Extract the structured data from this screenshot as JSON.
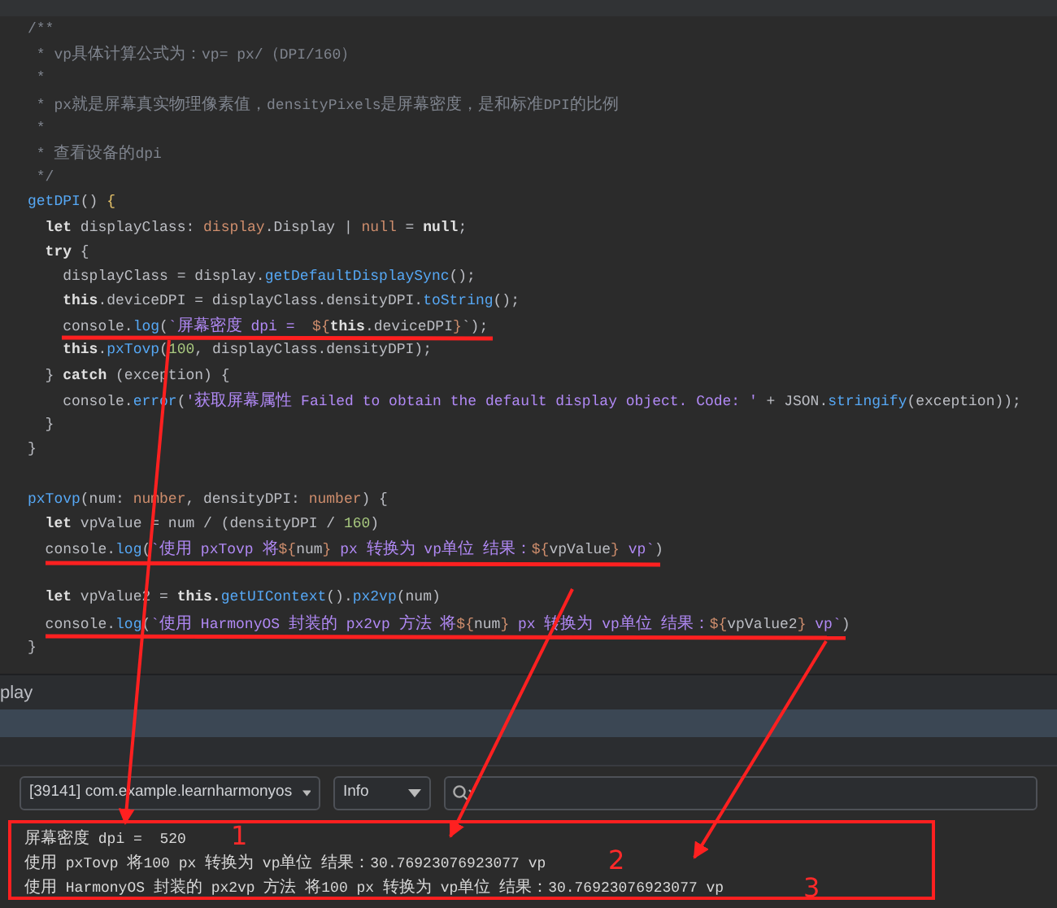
{
  "editor": {
    "lines": [
      {
        "kind": "code",
        "segs": [
          {
            "t": "/**",
            "color": "#7f848e"
          }
        ]
      },
      {
        "kind": "code",
        "segs": [
          {
            "t": " * vp具体计算公式为：vp= px/（DPI/160）",
            "color": "#7f848e"
          }
        ]
      },
      {
        "kind": "code",
        "segs": [
          {
            "t": " *",
            "color": "#7f848e"
          }
        ]
      },
      {
        "kind": "code",
        "segs": [
          {
            "t": " * px就是屏幕真实物理像素值，densityPixels是屏幕密度，是和标准DPI的比例",
            "color": "#7f848e"
          }
        ]
      },
      {
        "kind": "code",
        "segs": [
          {
            "t": " *",
            "color": "#7f848e"
          }
        ]
      },
      {
        "kind": "code",
        "segs": [
          {
            "t": " * 查看设备的dpi",
            "color": "#7f848e"
          }
        ]
      },
      {
        "kind": "code",
        "segs": [
          {
            "t": " */",
            "color": "#7f848e"
          }
        ]
      },
      {
        "kind": "code",
        "segs": [
          {
            "t": "getDPI",
            "color": "#56a8f5"
          },
          {
            "t": "() ",
            "color": "#bcbec4"
          },
          {
            "t": "{",
            "color": "#e8c46a"
          }
        ]
      },
      {
        "kind": "code",
        "segs": [
          {
            "t": "  let",
            "color": "#e0e0e0",
            "bold": true
          },
          {
            "t": " displayClass: ",
            "color": "#bcbec4"
          },
          {
            "t": "display",
            "color": "#cf8e6d"
          },
          {
            "t": ".Display | ",
            "color": "#bcbec4"
          },
          {
            "t": "null",
            "color": "#cf8e6d"
          },
          {
            "t": " = ",
            "color": "#bcbec4"
          },
          {
            "t": "null",
            "color": "#e0e0e0",
            "bold": true
          },
          {
            "t": ";",
            "color": "#bcbec4"
          }
        ]
      },
      {
        "kind": "code",
        "segs": [
          {
            "t": "  try",
            "color": "#e0e0e0",
            "bold": true
          },
          {
            "t": " {",
            "color": "#bcbec4"
          }
        ]
      },
      {
        "kind": "code",
        "segs": [
          {
            "t": "    displayClass = display.",
            "color": "#bcbec4"
          },
          {
            "t": "getDefaultDisplaySync",
            "color": "#56a8f5"
          },
          {
            "t": "();",
            "color": "#bcbec4"
          }
        ]
      },
      {
        "kind": "code",
        "segs": [
          {
            "t": "    this",
            "color": "#e0e0e0",
            "bold": true
          },
          {
            "t": ".deviceDPI = displayClass.densityDPI.",
            "color": "#bcbec4"
          },
          {
            "t": "toString",
            "color": "#56a8f5"
          },
          {
            "t": "();",
            "color": "#bcbec4"
          }
        ]
      },
      {
        "kind": "code",
        "segs": [
          {
            "t": "    console.",
            "color": "#bcbec4"
          },
          {
            "t": "log",
            "color": "#56a8f5"
          },
          {
            "t": "(",
            "color": "#bcbec4"
          },
          {
            "t": "`屏幕密度 dpi =  ",
            "color": "#b189f5"
          },
          {
            "t": "${",
            "color": "#cf8e6d"
          },
          {
            "t": "this",
            "color": "#e0e0e0",
            "bold": true
          },
          {
            "t": ".deviceDPI",
            "color": "#bcbec4"
          },
          {
            "t": "}",
            "color": "#cf8e6d"
          },
          {
            "t": "`);",
            "color": "#bcbec4"
          }
        ]
      },
      {
        "kind": "code",
        "segs": [
          {
            "t": "    this",
            "color": "#e0e0e0",
            "bold": true
          },
          {
            "t": ".",
            "color": "#bcbec4"
          },
          {
            "t": "pxTovp",
            "color": "#56a8f5"
          },
          {
            "t": "(",
            "color": "#bcbec4"
          },
          {
            "t": "100",
            "color": "#a8c97f"
          },
          {
            "t": ", displayClass.densityDPI);",
            "color": "#bcbec4"
          }
        ]
      },
      {
        "kind": "code",
        "segs": [
          {
            "t": "  } ",
            "color": "#bcbec4"
          },
          {
            "t": "catch",
            "color": "#e0e0e0",
            "bold": true
          },
          {
            "t": " (exception) {",
            "color": "#bcbec4"
          }
        ]
      },
      {
        "kind": "code",
        "segs": [
          {
            "t": "    console.",
            "color": "#bcbec4"
          },
          {
            "t": "error",
            "color": "#56a8f5"
          },
          {
            "t": "(",
            "color": "#bcbec4"
          },
          {
            "t": "'获取屏幕属性 Failed to obtain the default display object. Code: '",
            "color": "#b189f5"
          },
          {
            "t": " + JSON.",
            "color": "#bcbec4"
          },
          {
            "t": "stringify",
            "color": "#56a8f5"
          },
          {
            "t": "(exception));",
            "color": "#bcbec4"
          }
        ]
      },
      {
        "kind": "code",
        "segs": [
          {
            "t": "  }",
            "color": "#bcbec4"
          }
        ]
      },
      {
        "kind": "code",
        "segs": [
          {
            "t": "}",
            "color": "#bcbec4"
          }
        ]
      },
      {
        "kind": "blank"
      },
      {
        "kind": "code",
        "segs": [
          {
            "t": "pxTovp",
            "color": "#56a8f5"
          },
          {
            "t": "(num: ",
            "color": "#bcbec4"
          },
          {
            "t": "number",
            "color": "#cf8e6d"
          },
          {
            "t": ", densityDPI: ",
            "color": "#bcbec4"
          },
          {
            "t": "number",
            "color": "#cf8e6d"
          },
          {
            "t": ") {",
            "color": "#bcbec4"
          }
        ]
      },
      {
        "kind": "code",
        "segs": [
          {
            "t": "  let",
            "color": "#e0e0e0",
            "bold": true
          },
          {
            "t": " vpValue = num / (densityDPI / ",
            "color": "#bcbec4"
          },
          {
            "t": "160",
            "color": "#a8c97f"
          },
          {
            "t": ")",
            "color": "#bcbec4"
          }
        ]
      },
      {
        "kind": "code",
        "segs": [
          {
            "t": "  console.",
            "color": "#bcbec4"
          },
          {
            "t": "log",
            "color": "#56a8f5"
          },
          {
            "t": "(",
            "color": "#bcbec4"
          },
          {
            "t": "`使用 pxTovp 将",
            "color": "#b189f5"
          },
          {
            "t": "${",
            "color": "#cf8e6d"
          },
          {
            "t": "num",
            "color": "#bcbec4"
          },
          {
            "t": "}",
            "color": "#cf8e6d"
          },
          {
            "t": " px 转换为 vp单位 结果：",
            "color": "#b189f5"
          },
          {
            "t": "${",
            "color": "#cf8e6d"
          },
          {
            "t": "vpValue",
            "color": "#bcbec4"
          },
          {
            "t": "}",
            "color": "#cf8e6d"
          },
          {
            "t": " vp`",
            "color": "#b189f5"
          },
          {
            "t": ")",
            "color": "#bcbec4"
          }
        ]
      },
      {
        "kind": "blank"
      },
      {
        "kind": "code",
        "segs": [
          {
            "t": "  let",
            "color": "#e0e0e0",
            "bold": true
          },
          {
            "t": " vpValue2 = ",
            "color": "#bcbec4"
          },
          {
            "t": "this.",
            "color": "#e0e0e0",
            "bold": true
          },
          {
            "t": "getUIContext",
            "color": "#56a8f5"
          },
          {
            "t": "().",
            "color": "#bcbec4"
          },
          {
            "t": "px2vp",
            "color": "#56a8f5"
          },
          {
            "t": "(num)",
            "color": "#bcbec4"
          }
        ]
      },
      {
        "kind": "code",
        "segs": [
          {
            "t": "  console.",
            "color": "#bcbec4"
          },
          {
            "t": "log",
            "color": "#56a8f5"
          },
          {
            "t": "(",
            "color": "#bcbec4"
          },
          {
            "t": "`使用 HarmonyOS 封装的 px2vp 方法 将",
            "color": "#b189f5"
          },
          {
            "t": "${",
            "color": "#cf8e6d"
          },
          {
            "t": "num",
            "color": "#bcbec4"
          },
          {
            "t": "}",
            "color": "#cf8e6d"
          },
          {
            "t": " px 转换为 vp单位 结果：",
            "color": "#b189f5"
          },
          {
            "t": "${",
            "color": "#cf8e6d"
          },
          {
            "t": "vpValue2",
            "color": "#bcbec4"
          },
          {
            "t": "}",
            "color": "#cf8e6d"
          },
          {
            "t": " vp`",
            "color": "#b189f5"
          },
          {
            "t": ")",
            "color": "#bcbec4"
          }
        ]
      },
      {
        "kind": "code",
        "segs": [
          {
            "t": "}",
            "color": "#bcbec4"
          }
        ]
      }
    ]
  },
  "log_panel": {
    "tab_label": "play",
    "process_dropdown": "[39141] com.example.learnharmonyos",
    "level_dropdown": "Info",
    "log_lines": [
      "屏幕密度 dpi =  520",
      "使用 pxTovp 将100 px 转换为 vp单位 结果：30.76923076923077 vp",
      "使用 HarmonyOS 封装的 px2vp 方法 将100 px 转换为 vp单位 结果：30.76923076923077 vp"
    ]
  },
  "annotations": {
    "numbers": [
      "1",
      "2",
      "3"
    ]
  }
}
